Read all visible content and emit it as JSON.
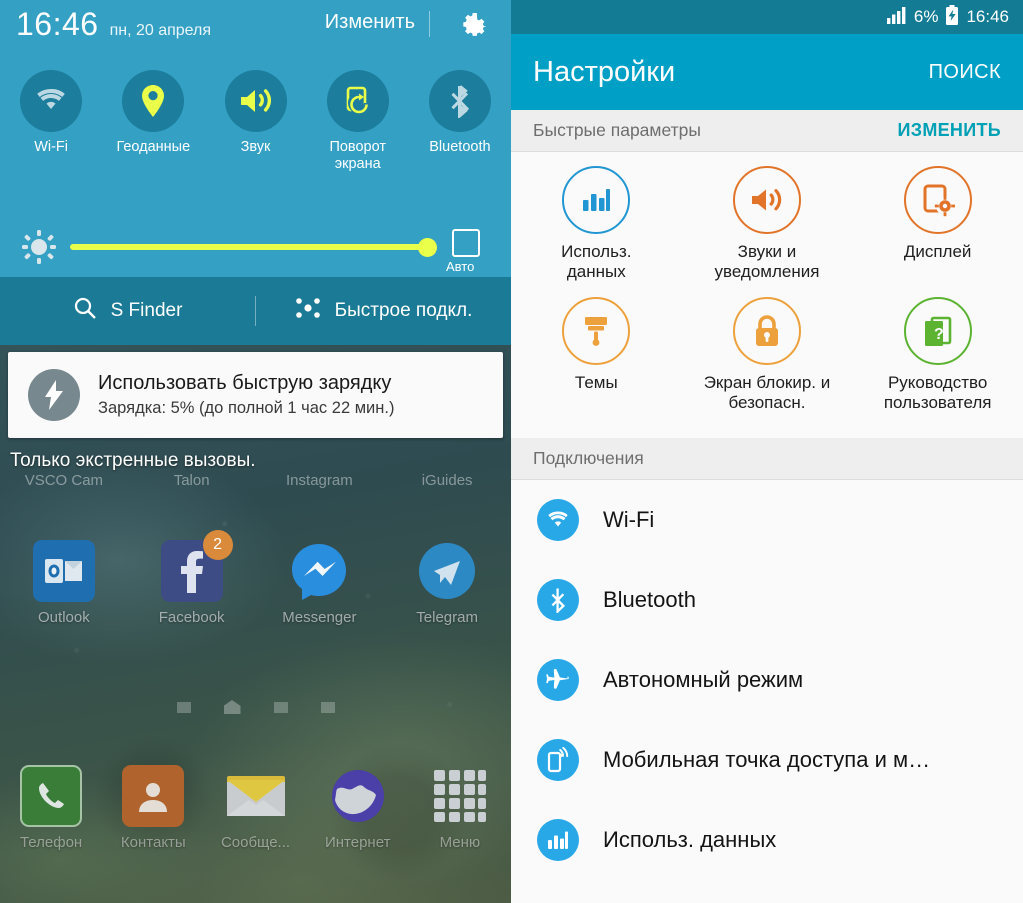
{
  "colors": {
    "shade_blue": "#33a0c4",
    "finder_blue": "#1b7b96",
    "toggle_circle": "#1c7d9c",
    "accent_yellow": "#eaff4a",
    "statusbar_teal": "#137b94",
    "appbar_cyan": "#00a0c6",
    "link_teal": "#00a0b5",
    "list_icon_blue": "#29a8e8",
    "qs_blue": "#2196d3",
    "qs_orange": "#e2742a",
    "qs_amber": "#eda13c",
    "qs_green": "#5cb331",
    "badge_orange": "#d98a3a"
  },
  "left_panel": {
    "clock": "16:46",
    "date": "пн, 20 апреля",
    "edit_label": "Изменить",
    "gear_icon": "gear-icon",
    "toggles": [
      {
        "label": "Wi-Fi",
        "icon": "wifi-icon",
        "active": false
      },
      {
        "label": "Геоданные",
        "icon": "location-pin-icon",
        "active": true
      },
      {
        "label": "Звук",
        "icon": "sound-icon",
        "active": true
      },
      {
        "label": "Поворот\nэкрана",
        "label_line1": "Поворот",
        "label_line2": "экрана",
        "icon": "screen-rotation-icon",
        "active": true
      },
      {
        "label": "Bluetooth",
        "icon": "bluetooth-icon",
        "active": false
      }
    ],
    "brightness": {
      "icon": "brightness-sun-icon",
      "value_percent": 100,
      "auto_label": "Авто",
      "auto_checked": false
    },
    "finder": {
      "s_finder_label": "S Finder",
      "s_finder_icon": "search-icon",
      "quick_connect_label": "Быстрое подкл.",
      "quick_connect_icon": "quick-connect-icon"
    },
    "notification": {
      "icon": "fast-charging-bolt-icon",
      "title": "Использовать быструю зарядку",
      "subtitle": "Зарядка: 5% (до полной 1 час 22 мин.)"
    },
    "emergency_text": "Только экстренные вызовы.",
    "home_row_top_labels": [
      "VSCO Cam",
      "Talon",
      "Instagram",
      "iGuides"
    ],
    "home_apps": [
      {
        "label": "Outlook",
        "icon": "outlook-icon",
        "badge": null
      },
      {
        "label": "Facebook",
        "icon": "facebook-icon",
        "badge": "2"
      },
      {
        "label": "Messenger",
        "icon": "messenger-icon",
        "badge": null
      },
      {
        "label": "Telegram",
        "icon": "telegram-icon",
        "badge": null
      }
    ],
    "dock_apps": [
      {
        "label": "Телефон",
        "icon": "phone-icon"
      },
      {
        "label": "Контакты",
        "icon": "contacts-icon"
      },
      {
        "label": "Сообще...",
        "icon": "messages-icon"
      },
      {
        "label": "Интернет",
        "icon": "browser-globe-icon"
      },
      {
        "label": "Меню",
        "icon": "app-drawer-icon"
      }
    ]
  },
  "right_panel": {
    "statusbar": {
      "signal_icon": "signal-bars-icon",
      "battery_text": "6%",
      "battery_icon": "battery-charging-icon",
      "clock": "16:46"
    },
    "appbar": {
      "title": "Настройки",
      "search_label": "ПОИСК"
    },
    "quick_settings_header": {
      "title": "Быстрые параметры",
      "action": "ИЗМЕНИТЬ"
    },
    "quick_settings": [
      {
        "label": "Использ. данных",
        "line1": "Использ.",
        "line2": "данных",
        "icon": "data-usage-icon",
        "color": "#2196d3"
      },
      {
        "label": "Звуки и уведомления",
        "line1": "Звуки и",
        "line2": "уведомления",
        "icon": "sound-notifications-icon",
        "color": "#e2742a"
      },
      {
        "label": "Дисплей",
        "line1": "Дисплей",
        "line2": "",
        "icon": "display-icon",
        "color": "#e2742a"
      },
      {
        "label": "Темы",
        "line1": "Темы",
        "line2": "",
        "icon": "themes-brush-icon",
        "color": "#eda13c"
      },
      {
        "label": "Экран блокир. и безопасн.",
        "line1": "Экран блокир. и",
        "line2": "безопасн.",
        "icon": "lock-icon",
        "color": "#eda13c"
      },
      {
        "label": "Руководство пользователя",
        "line1": "Руководство",
        "line2": "пользователя",
        "icon": "user-manual-icon",
        "color": "#5cb331"
      }
    ],
    "connections_header": "Подключения",
    "connections": [
      {
        "label": "Wi-Fi",
        "icon": "wifi-icon"
      },
      {
        "label": "Bluetooth",
        "icon": "bluetooth-icon"
      },
      {
        "label": "Автономный режим",
        "icon": "airplane-icon"
      },
      {
        "label": "Мобильная точка доступа и м…",
        "icon": "hotspot-icon"
      },
      {
        "label": "Использ. данных",
        "icon": "data-usage-icon"
      }
    ]
  }
}
